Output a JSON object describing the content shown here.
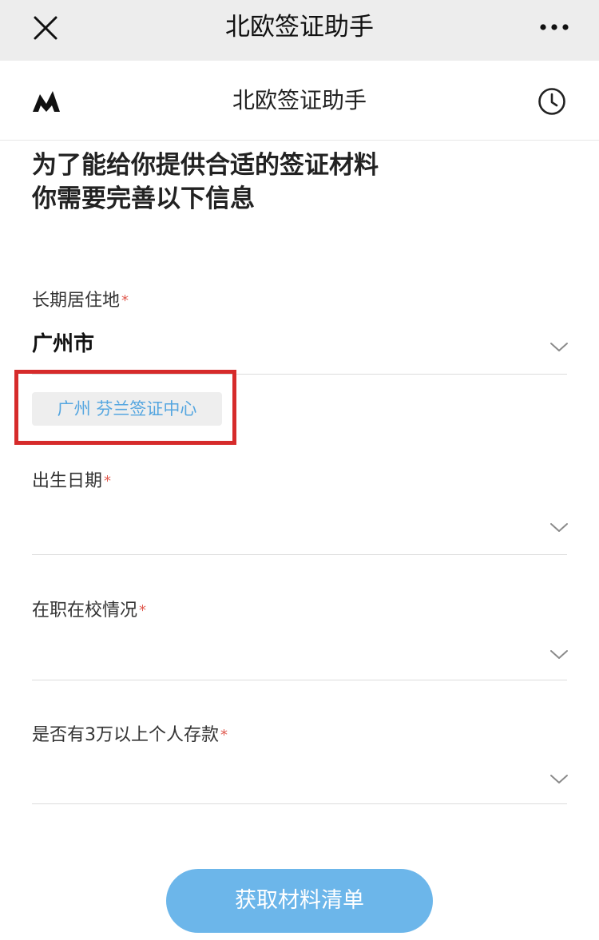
{
  "window": {
    "title": "北欧签证助手",
    "close_icon": "close-icon",
    "more_icon": "more-icon"
  },
  "header": {
    "title": "北欧签证助手",
    "logo_icon": "brand-logo-icon",
    "history_icon": "clock-icon"
  },
  "headline": {
    "line1": "为了能给你提供合适的签证材料",
    "line2": "你需要完善以下信息"
  },
  "form": {
    "residence": {
      "label": "长期居住地",
      "required_mark": "*",
      "value": "广州市"
    },
    "visa_center": {
      "label": "广州 芬兰签证中心"
    },
    "birth_date": {
      "label": "出生日期",
      "required_mark": "*",
      "value": ""
    },
    "employment": {
      "label": "在职在校情况",
      "required_mark": "*",
      "value": ""
    },
    "savings": {
      "label": "是否有3万以上个人存款",
      "required_mark": "*",
      "value": ""
    }
  },
  "submit": {
    "label": "获取材料清单"
  },
  "colors": {
    "topbar_bg": "#ededed",
    "accent_blue": "#6cb6ea",
    "tag_text": "#55a6e0",
    "required_red": "#e05a4f",
    "highlight_red": "#d62b2b"
  }
}
